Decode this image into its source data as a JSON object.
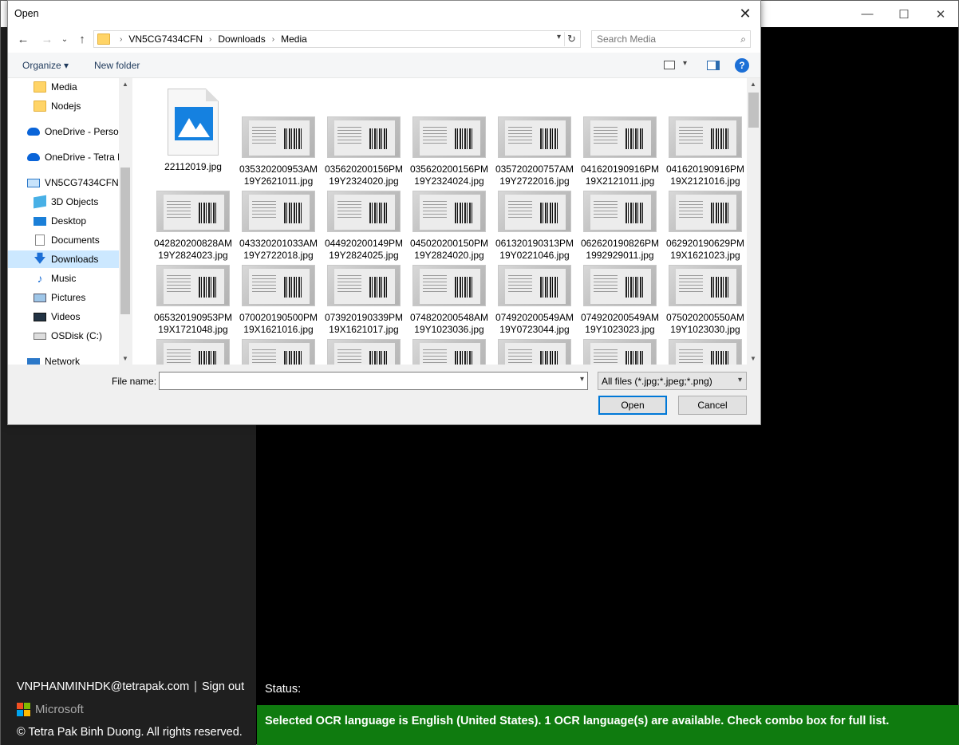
{
  "app": {
    "window_controls": [
      "—",
      "☐",
      "✕"
    ],
    "user_email": "VNPHANMINHDK@tetrapak.com",
    "separator": "|",
    "sign_out": "Sign out",
    "brand": "Microsoft",
    "brand_colors": [
      "#f25022",
      "#7fba00",
      "#00a4ef",
      "#ffb900"
    ],
    "copyright": "© Tetra Pak Binh Duong. All rights reserved.",
    "status_label": "Status:",
    "status_message": "Selected OCR language is English (United States). 1 OCR language(s) are available. Check combo box for full list.",
    "status_color": "#0f7b0f"
  },
  "dialog": {
    "title": "Open",
    "close_glyph": "✕",
    "nav": {
      "back": "←",
      "forward": "→",
      "recent": "⌄",
      "up": "↑"
    },
    "breadcrumb": [
      "VN5CG7434CFN",
      "Downloads",
      "Media"
    ],
    "crumb_sep": "›",
    "refresh_glyph": "↻",
    "search_placeholder": "Search Media",
    "toolbar": {
      "organize": "Organize ▾",
      "new_folder": "New folder",
      "help": "?"
    },
    "tree": [
      {
        "label": "Media",
        "icon": "folder-icon"
      },
      {
        "label": "Nodejs",
        "icon": "folder-icon"
      },
      {
        "label": "OneDrive - Person",
        "icon": "onedrive-icon"
      },
      {
        "label": "OneDrive - Tetra P",
        "icon": "onedrive-icon"
      },
      {
        "label": "VN5CG7434CFN",
        "icon": "computer-icon"
      },
      {
        "label": "3D Objects",
        "icon": "3d-objects-icon"
      },
      {
        "label": "Desktop",
        "icon": "desktop-icon"
      },
      {
        "label": "Documents",
        "icon": "documents-icon"
      },
      {
        "label": "Downloads",
        "icon": "downloads-icon",
        "selected": true
      },
      {
        "label": "Music",
        "icon": "music-icon"
      },
      {
        "label": "Pictures",
        "icon": "pictures-icon"
      },
      {
        "label": "Videos",
        "icon": "videos-icon"
      },
      {
        "label": "OSDisk (C:)",
        "icon": "disk-icon"
      },
      {
        "label": "Network",
        "icon": "network-icon"
      }
    ],
    "files": [
      {
        "line1": "22112019.jpg",
        "line2": "",
        "kind": "image-icon"
      },
      {
        "line1": "035320200953AM",
        "line2": "19Y2621011.jpg"
      },
      {
        "line1": "035620200156PM",
        "line2": "19Y2324020.jpg"
      },
      {
        "line1": "035620200156PM",
        "line2": "19Y2324024.jpg"
      },
      {
        "line1": "035720200757AM",
        "line2": "19Y2722016.jpg"
      },
      {
        "line1": "041620190916PM",
        "line2": "19X2121011.jpg"
      },
      {
        "line1": "041620190916PM",
        "line2": "19X2121016.jpg"
      },
      {
        "line1": "042820200828AM",
        "line2": "19Y2824023.jpg"
      },
      {
        "line1": "043320201033AM",
        "line2": "19Y2722018.jpg"
      },
      {
        "line1": "044920200149PM",
        "line2": "19Y2824025.jpg"
      },
      {
        "line1": "045020200150PM",
        "line2": "19Y2824020.jpg"
      },
      {
        "line1": "061320190313PM",
        "line2": "19Y0221046.jpg"
      },
      {
        "line1": "062620190826PM",
        "line2": "1992929011.jpg"
      },
      {
        "line1": "062920190629PM",
        "line2": "19X1621023.jpg"
      },
      {
        "line1": "065320190953PM",
        "line2": "19X1721048.jpg"
      },
      {
        "line1": "070020190500PM",
        "line2": "19X1621016.jpg"
      },
      {
        "line1": "073920190339PM",
        "line2": "19X1621017.jpg"
      },
      {
        "line1": "074820200548AM",
        "line2": "19Y1023036.jpg"
      },
      {
        "line1": "074920200549AM",
        "line2": "19Y0723044.jpg"
      },
      {
        "line1": "074920200549AM",
        "line2": "19Y1023023.jpg"
      },
      {
        "line1": "075020200550AM",
        "line2": "19Y1023030.jpg"
      },
      {
        "line1": "",
        "line2": ""
      },
      {
        "line1": "",
        "line2": ""
      },
      {
        "line1": "",
        "line2": ""
      },
      {
        "line1": "",
        "line2": ""
      },
      {
        "line1": "",
        "line2": ""
      },
      {
        "line1": "",
        "line2": ""
      },
      {
        "line1": "",
        "line2": ""
      }
    ],
    "file_name_label": "File name:",
    "file_name_value": "",
    "file_type_filter": "All files (*.jpg;*.jpeg;*.png)",
    "open_button": "Open",
    "cancel_button": "Cancel"
  }
}
